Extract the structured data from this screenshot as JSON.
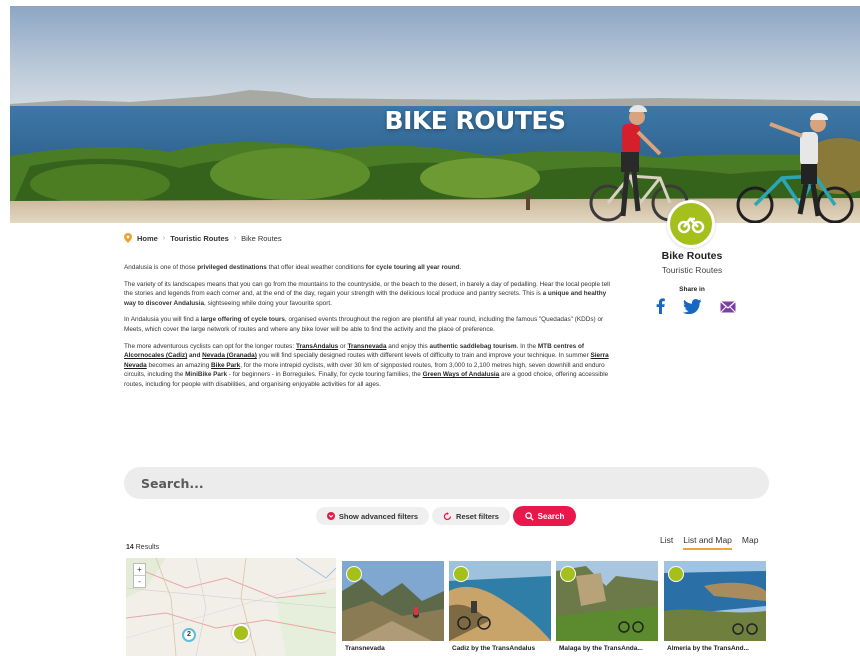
{
  "hero": {
    "title": "BIKE ROUTES"
  },
  "breadcrumb": {
    "home": "Home",
    "section": "Touristic Routes",
    "current": "Bike Routes"
  },
  "article": {
    "p1": {
      "a": "Andalusia is one of those ",
      "b1": "privileged destinations",
      "c": " that offer ideal weather conditions ",
      "b2": "for cycle touring all year round",
      "d": "."
    },
    "p2": {
      "a": "The variety of its landscapes means that you can go from the mountains to the countryside, or the beach to the desert, in barely a day of pedalling. Hear the local people tell the stories and legends from each corner and, at the end of the day, regain your strength with the delicious local produce and pantry secrets. This is ",
      "b1": "a unique and healthy way to discover Andalusia",
      "c": ", sightseeing while doing your favourite sport."
    },
    "p3": {
      "a": "In Andalusia you will find a ",
      "b1": "large offering of cycle tours",
      "c": ", organised events throughout the region are plentiful all year round, including the famous \"Quedadas\" (KDDs) or Meets, which cover the large network of routes and where any bike lover will be able to find the activity and the place of preference."
    },
    "p4": {
      "a": "The more adventurous cyclists can opt for the longer routes: ",
      "l1": "TransAndalus",
      "or": " or ",
      "l2": "Transnevada",
      "b": " and enjoy this ",
      "b1": "authentic saddlebag tourism",
      "c": ". In the ",
      "b2": "MTB centres of ",
      "l3": "Alcornocales (Cadiz)",
      "and": " and ",
      "l4": "Nevada (Granada)",
      "d": " you will find specially designed routes with different levels of difficulty to train and improve your technique. In summer ",
      "l5": "Sierra Nevada",
      "e": " becomes an amazing ",
      "l6": "Bike Park",
      "f": ", for the more intrepid cyclists, with over 30 km of signposted routes, from 3,000 to 2,100 metres high, seven downhill and enduro circuits, including the ",
      "b3": "MiniBike Park",
      "g": " - for beginners - in Borreguiles. Finally, for cycle touring families, the ",
      "l7": "Green Ways of Andalusia",
      "h": " are a good choice, offering accessible routes, including for people with disabilities, and organising enjoyable activities for all ages."
    }
  },
  "sidebar": {
    "title": "Bike Routes",
    "subtitle": "Touristic Routes",
    "share_label": "Share in",
    "share_icons": [
      "facebook-icon",
      "twitter-icon",
      "email-icon"
    ]
  },
  "search": {
    "placeholder": "Search...",
    "advanced_label": "Show advanced filters",
    "reset_label": "Reset filters",
    "search_label": "Search"
  },
  "results": {
    "count": "14",
    "count_label": " Results",
    "views": [
      "List",
      "List and Map",
      "Map"
    ],
    "active_view": "List and Map"
  },
  "map": {
    "zoom_in": "+",
    "zoom_out": "-",
    "cluster_count": "2"
  },
  "cards": [
    {
      "title": "Transnevada"
    },
    {
      "title": "Cadiz by the TransAndalus"
    },
    {
      "title": "Malaga by the TransAnda..."
    },
    {
      "title": "Almería by the TransAnd..."
    }
  ],
  "colors": {
    "accent_green": "#a5bf1d",
    "search_red": "#e8184c",
    "active_tab": "#f2a23a",
    "share_blue": "#1a67c2",
    "email_purple": "#7b3fa5"
  }
}
